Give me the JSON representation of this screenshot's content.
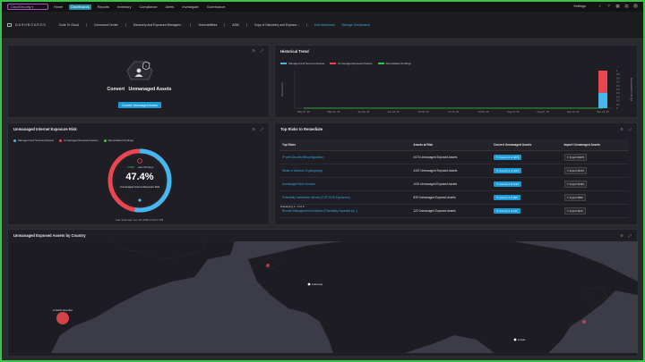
{
  "topbar": {
    "brand": "CloudSecurity ▾",
    "nav": [
      "Home",
      "Dashboards",
      "Reports",
      "Inventory",
      "Compliance",
      "Alerts",
      "Investigate",
      "Governance"
    ],
    "active_index": 1,
    "settings_label": "Settings"
  },
  "dashbar": {
    "title": "DASHBOARDS",
    "tabs": [
      "Code To Cloud",
      "Command Center",
      "Discovery and Exposure Managem...",
      "Vulnerabilities",
      "ASM",
      "Copy of Discovery and Exposur..."
    ],
    "links": [
      "Edit dashboard",
      "Manage Dashboards"
    ]
  },
  "convert_panel": {
    "heading_a": "Convert",
    "heading_b": "Unmanaged Assets",
    "button_label": "Convert Unmanaged Assets"
  },
  "trend_panel": {
    "title": "Historical Trend",
    "legend": [
      {
        "label": "Managed and Secured Assets",
        "color": "#45b8f0"
      },
      {
        "label": "Unmanaged Exposed Assets",
        "color": "#e8474f"
      },
      {
        "label": "Remediated Findings",
        "color": "#3ec24a"
      }
    ],
    "y_left_label": "Asset Count",
    "y_right_label": "Remediated Findings"
  },
  "chart_data": {
    "type": "bar",
    "categories": [
      "May 07, 25",
      "May 21, 25",
      "Jun 04, 25",
      "Jun 18, 25",
      "Jul 02, 25",
      "Jul 16, 25",
      "Jul 30, 25",
      "Aug 13, 25",
      "Aug 27, 25",
      "Sep 10, 25",
      "Sep 24, 25"
    ],
    "x_tick_labels": [
      "May 07, 25",
      "May 21, 25",
      "Jun 04, 25",
      "Jun 18, 25",
      "Jul 02, 25",
      "Jul 16, 25",
      "Jul 30, 25",
      "Aug 13, 25",
      "Aug 27, 25",
      "Sep 10, 25",
      "Sep 24, 25"
    ],
    "series": [
      {
        "name": "Managed and Secured Assets",
        "values": [
          0,
          0,
          0,
          0,
          0,
          0,
          0,
          0,
          0,
          0,
          41.2
        ],
        "color": "#45b8f0"
      },
      {
        "name": "Unmanaged Exposed Assets",
        "values": [
          0,
          0,
          0,
          0,
          0,
          0,
          0,
          0,
          0,
          0,
          58.8
        ],
        "color": "#e8474f"
      },
      {
        "name": "Remediated Findings",
        "values": [
          0,
          0,
          0,
          0,
          0,
          0,
          0,
          0,
          0,
          0,
          0
        ],
        "color": "#3ec24a"
      }
    ],
    "ylim": [
      0,
      100
    ],
    "y_right_ticks": [
      "0",
      "0.1",
      "0.2",
      "0.3",
      "0.4",
      "0.5",
      "0.6",
      "0.7",
      "0.8",
      "0.9",
      "1"
    ]
  },
  "risk_panel": {
    "title": "Unmanaged Internet Exposure Risk",
    "legend": [
      {
        "label": "Managed and Secured Assets",
        "color": "#45b8f0"
      },
      {
        "label": "Unmanaged Exposed Assets",
        "color": "#e8474f"
      },
      {
        "label": "Remediated Findings",
        "color": "#3ec24a"
      }
    ],
    "trend": "↓ 0.0%",
    "trend_caption": "Last 30 Days",
    "percent": "47.4%",
    "percent_value": 47.4,
    "caption": "Unmanaged Internet Exposure Risk",
    "last_scanned": "Last Scanned: Jun 18, 2025 4:29:07 PM"
  },
  "top_risks": {
    "title": "Top Risks to Remediate",
    "headers": [
      "Top Risks",
      "Assets at Risk",
      "Convert Unmanaged Assets",
      "Import Unmanaged Assets"
    ],
    "rows": [
      {
        "risk": "IP with Security Misconfiguration",
        "assets": "4473 Unmanaged Exposed Assets",
        "convert": "Convert 4 of 4473",
        "import": "4473"
      },
      {
        "risk": "Weak or Insecure Cryptography",
        "assets": "4167 Unmanaged Exposed Assets",
        "convert": "Convert 4 of 4167",
        "import": "4167"
      },
      {
        "risk": "Unmanaged Web Domain",
        "assets": "1191 Unmanaged Exposed Assets",
        "convert": "Convert 4 of 1191",
        "import": "1191"
      },
      {
        "risk": "Potentially Vulnerable Service (CVE 2025 Exposures)",
        "assets": "839 Unmanaged Exposed Assets",
        "convert": "Convert 4 of 839",
        "import": "839"
      },
      {
        "risk": "Remote Management Interfaces (Potentially Impacted by...)",
        "assets": "122 Unmanaged Exposed Assets",
        "convert": "Convert 4 of 122",
        "import": "122"
      }
    ],
    "import_label": "Import",
    "footer": "Displaying 1 - 5 of 5"
  },
  "map_panel": {
    "title": "Unmanaged Exposed Assets by Country",
    "markers": [
      {
        "label": "North America",
        "size": "large"
      },
      {
        "label": "Europe",
        "size": "small"
      },
      {
        "label": "Asia",
        "size": "small"
      }
    ]
  }
}
